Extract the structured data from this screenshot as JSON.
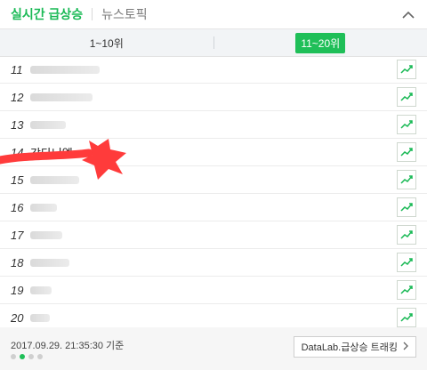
{
  "header": {
    "main_tab": "실시간 급상승",
    "sub_tab": "뉴스토픽"
  },
  "segment": {
    "tab1": "1~10위",
    "tab2": "11~20위"
  },
  "list": {
    "items": [
      {
        "rank": "11",
        "keyword": ""
      },
      {
        "rank": "12",
        "keyword": ""
      },
      {
        "rank": "13",
        "keyword": ""
      },
      {
        "rank": "14",
        "keyword": "강다니엘"
      },
      {
        "rank": "15",
        "keyword": ""
      },
      {
        "rank": "16",
        "keyword": ""
      },
      {
        "rank": "17",
        "keyword": ""
      },
      {
        "rank": "18",
        "keyword": ""
      },
      {
        "rank": "19",
        "keyword": ""
      },
      {
        "rank": "20",
        "keyword": ""
      }
    ]
  },
  "footer": {
    "timestamp": "2017.09.29. 21:35:30 기준",
    "datalab_label": "DataLab.급상승 트래킹"
  },
  "icons": {
    "trend": "chart-trend-icon",
    "collapse": "chevron-up-icon",
    "datalab_arrow": "chevron-right-icon"
  },
  "colors": {
    "accent": "#19b955",
    "active_tab": "#1fbf58",
    "redaction": "#ff3b3b"
  }
}
